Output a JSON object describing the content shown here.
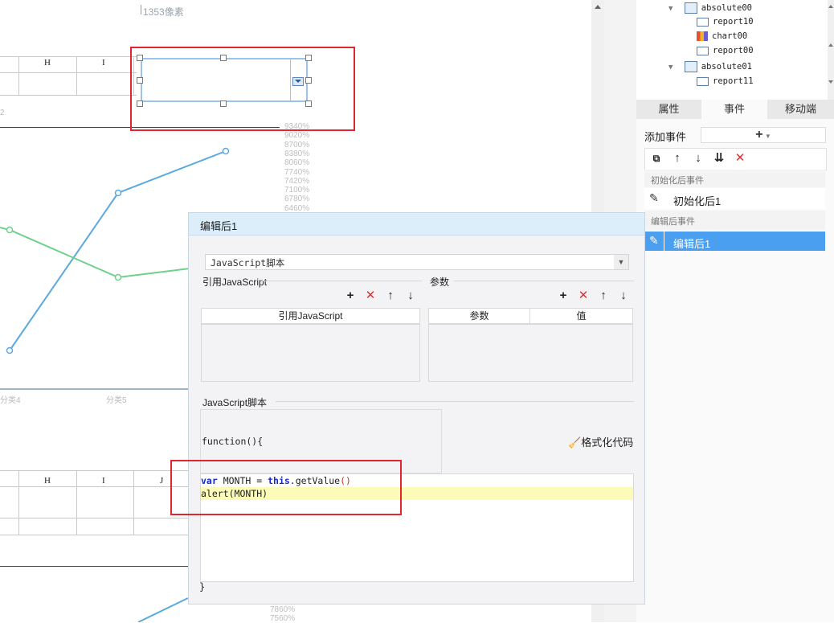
{
  "canvas": {
    "ruler_label": "1353像素",
    "top_columns": [
      "H",
      "I"
    ],
    "bottom_columns": [
      "H",
      "I",
      "J"
    ],
    "top_row_number": "2",
    "pct_axis_top": [
      "9340%",
      "9020%",
      "8700%",
      "8380%",
      "8060%",
      "7740%",
      "7420%",
      "7100%",
      "6780%",
      "6460%"
    ],
    "pct_axis_bottom": [
      "7860%",
      "7560%"
    ],
    "category_labels": [
      "分类4",
      "分类5"
    ],
    "series_colors": {
      "blue": "#5aa9e0",
      "green": "#6fd08c"
    }
  },
  "tree": {
    "items": [
      {
        "label": "absolute00",
        "type": "container"
      },
      {
        "label": "report10",
        "type": "report"
      },
      {
        "label": "chart00",
        "type": "chart"
      },
      {
        "label": "report00",
        "type": "report"
      },
      {
        "label": "absolute01",
        "type": "container"
      },
      {
        "label": "report11",
        "type": "report"
      }
    ]
  },
  "tabs": [
    "属性",
    "事件",
    "移动端"
  ],
  "events_panel": {
    "add_event_label": "添加事件",
    "add_button": "+",
    "section_init": "初始化后事件",
    "item_init": "初始化后1",
    "section_edit": "编辑后事件",
    "item_edit": "编辑后1"
  },
  "dialog": {
    "title": "编辑后1",
    "type_select": "JavaScript脚本",
    "ref_js_title": "引用JavaScript",
    "ref_js_column": "引用JavaScript",
    "params_title": "参数",
    "params_columns": [
      "参数",
      "值"
    ],
    "script_title": "JavaScript脚本",
    "function_header": "function(){",
    "format_code_label": "格式化代码",
    "code": {
      "kw_var": "var",
      "var_name": " MONTH = ",
      "kw_this": "this",
      "call": ".getValue",
      "parens": "()",
      "alert_line": "alert(MONTH)"
    },
    "closing_brace": "}"
  }
}
